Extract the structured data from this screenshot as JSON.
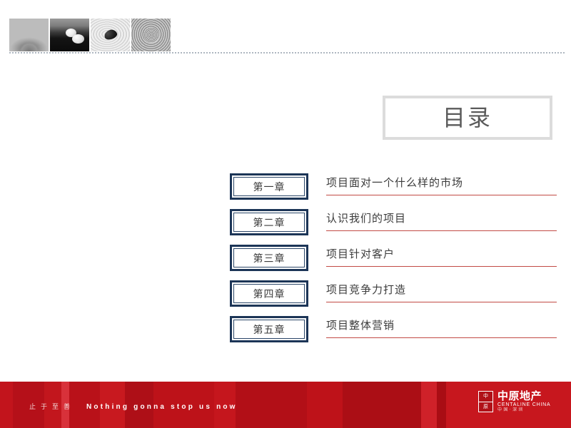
{
  "slide": {
    "title": "目录",
    "background_color": "#ffffff"
  },
  "header": {
    "photos": [
      {
        "name": "sand-mound-photo",
        "alt": "sand mound"
      },
      {
        "name": "white-stones-photo",
        "alt": "white stones on dark water"
      },
      {
        "name": "dark-stone-photo",
        "alt": "dark stone on raked sand"
      },
      {
        "name": "water-ripples-photo",
        "alt": "concentric water ripples"
      }
    ]
  },
  "toc": {
    "entries": [
      {
        "chapter": "第一章",
        "title": "项目面对一个什么样的市场"
      },
      {
        "chapter": "第二章",
        "title": "认识我们的项目"
      },
      {
        "chapter": "第三章",
        "title": "项目针对客户"
      },
      {
        "chapter": "第四章",
        "title": "项目竞争力打造"
      },
      {
        "chapter": "第五章",
        "title": "项目整体营销"
      }
    ]
  },
  "footer": {
    "tagline_cn": "止于至善",
    "tagline_en": "Nothing gonna stop us now",
    "logo": {
      "emblem_top": "中",
      "emblem_bottom": "原",
      "name_cn": "中原地产",
      "name_en": "CENTALINE CHINA",
      "sub": "中国·深圳"
    }
  },
  "colors": {
    "footer_red": "#bd1219",
    "accent_red": "#c24a45",
    "chapter_border": "#1c3557",
    "title_border": "#dcdcdc",
    "title_text": "#5a5a5a",
    "body_text": "#3c3c3c"
  }
}
